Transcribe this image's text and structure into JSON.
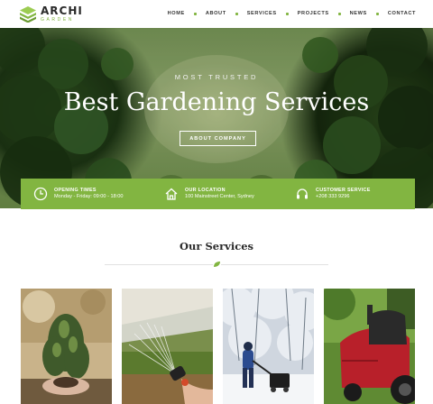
{
  "logo": {
    "title": "ARCHI",
    "subtitle": "GARDEN"
  },
  "nav": {
    "items": [
      "HOME",
      "ABOUT",
      "SERVICES",
      "PROJECTS",
      "NEWS",
      "CONTACT"
    ]
  },
  "hero": {
    "eyebrow": "MOST TRUSTED",
    "title": "Best Gardening Services",
    "button": "ABOUT COMPANY"
  },
  "info": [
    {
      "icon": "clock-icon",
      "label": "OPENING TIMES",
      "value": "Monday - Friday: 09:00 - 18:00"
    },
    {
      "icon": "home-icon",
      "label": "OUR LOCATION",
      "value": "100 Mainstreet Center, Sydney"
    },
    {
      "icon": "headset-icon",
      "label": "CUSTOMER SERVICE",
      "value": "+208 333 9296"
    }
  ],
  "services": {
    "title": "Our Services",
    "cards": [
      {
        "icon": "plant-photo"
      },
      {
        "icon": "watering-hose-photo"
      },
      {
        "icon": "snow-blower-photo"
      },
      {
        "icon": "lawn-mower-photo"
      }
    ]
  },
  "colors": {
    "accent": "#82b541",
    "text": "#2a2a2a"
  }
}
